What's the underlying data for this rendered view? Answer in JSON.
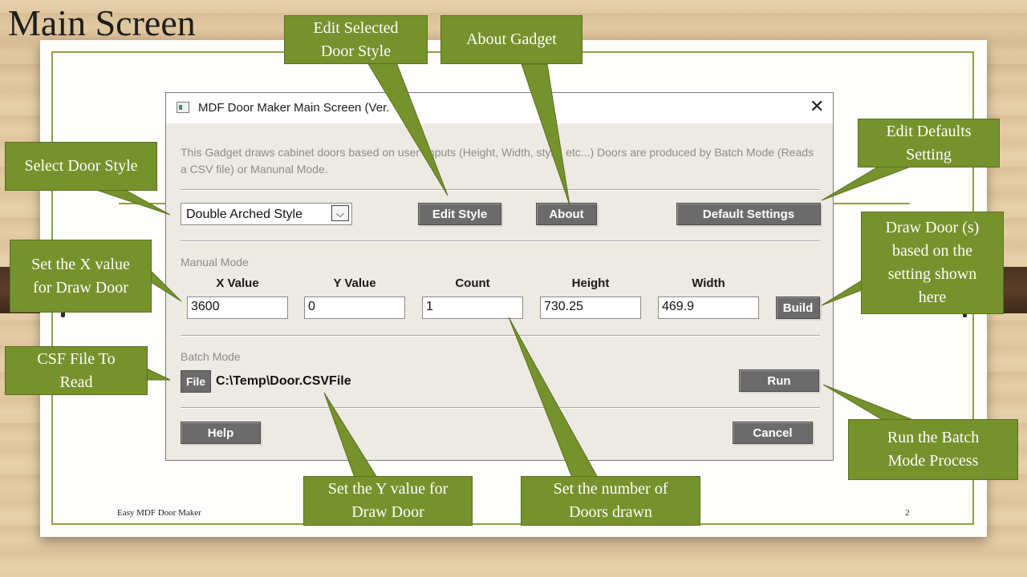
{
  "slide": {
    "title": "Main Screen",
    "footer_left": "Easy MDF Door Maker",
    "page_number": "2"
  },
  "dialog": {
    "title": "MDF Door Maker Main Screen (Ver.",
    "description": "This Gadget draws cabinet doors based on user imputs (Height, Width, style, etc...) Doors are produced by Batch Mode (Reads a CSV file) or Manunal Mode.",
    "style_select_value": "Double Arched Style",
    "edit_style_label": "Edit Style",
    "about_label": "About",
    "default_settings_label": "Default Settings",
    "manual_mode_label": "Manual Mode",
    "columns": [
      "X Value",
      "Y Value",
      "Count",
      "Height",
      "Width"
    ],
    "values": [
      "3600",
      "0",
      "1",
      "730.25",
      "469.9"
    ],
    "build_label": "Build",
    "batch_mode_label": "Batch Mode",
    "file_label": "File",
    "file_path": "C:\\Temp\\Door.CSVFile",
    "run_label": "Run",
    "help_label": "Help",
    "cancel_label": "Cancel",
    "close_glyph": "✕",
    "dropdown_glyph": "⌵"
  },
  "callouts": {
    "edit_selected_style": "Edit Selected\nDoor Style",
    "about_gadget": "About Gadget",
    "edit_defaults": "Edit Defaults\nSetting",
    "select_door_style": "Select Door Style",
    "draw_door": "Draw Door (s)\nbased on the\nsetting shown\nhere",
    "set_x": "Set the X value\nfor Draw Door",
    "csf_file": "CSF File To\nRead",
    "run_batch": "Run the Batch\nMode Process",
    "set_y": "Set the Y value for\nDraw Door",
    "set_count": "Set the number of\nDoors drawn"
  },
  "colors": {
    "callout_green": "#76922c",
    "button_gray": "#6b6b6b",
    "dialog_bg": "#edeae3"
  }
}
